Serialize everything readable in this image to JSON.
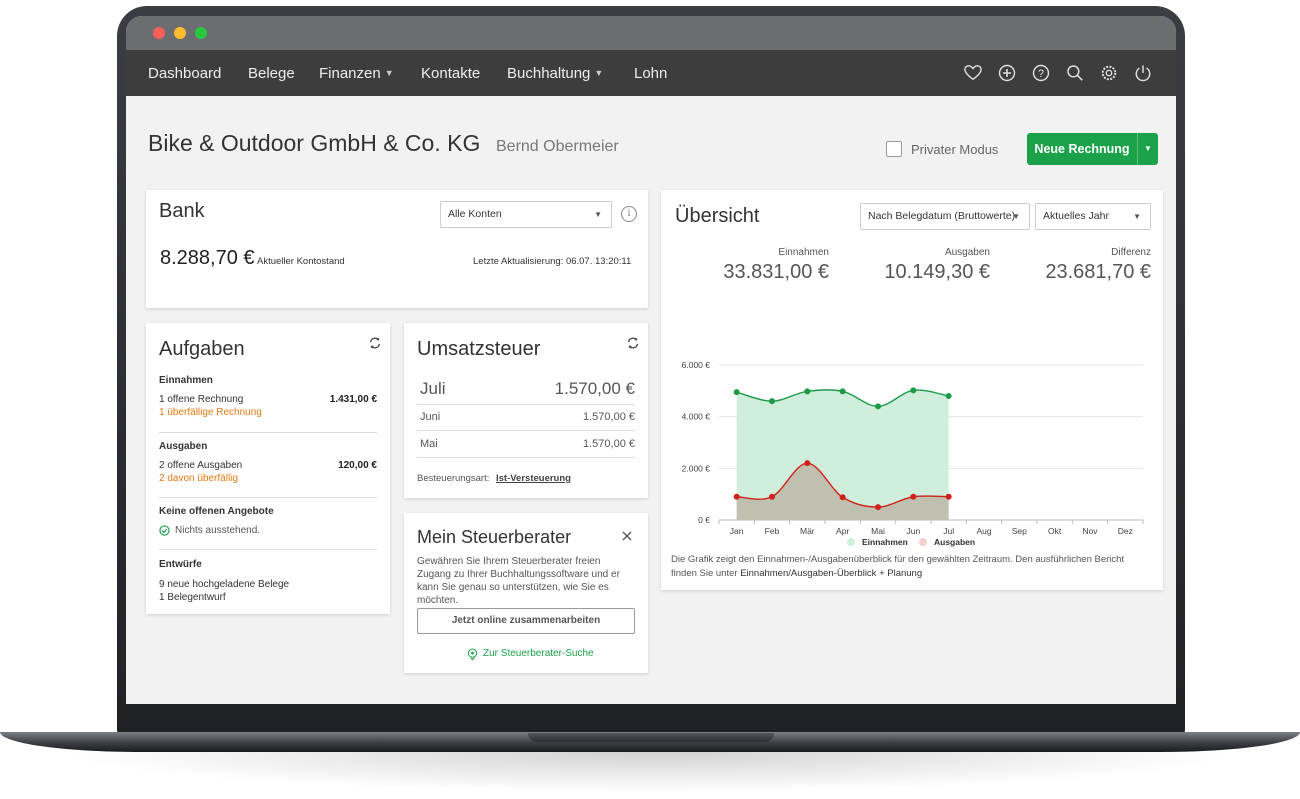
{
  "nav": {
    "items": [
      {
        "label": "Dashboard",
        "dropdown": false
      },
      {
        "label": "Belege",
        "dropdown": false
      },
      {
        "label": "Finanzen",
        "dropdown": true
      },
      {
        "label": "Kontakte",
        "dropdown": false
      },
      {
        "label": "Buchhaltung",
        "dropdown": true
      },
      {
        "label": "Lohn",
        "dropdown": false
      }
    ],
    "icons": [
      "heart-icon",
      "plus-circle-icon",
      "help-icon",
      "search-icon",
      "settings-icon",
      "power-icon"
    ]
  },
  "header": {
    "company": "Bike & Outdoor GmbH & Co. KG",
    "user": "Bernd Obermeier",
    "private_mode_label": "Privater Modus",
    "new_invoice_label": "Neue Rechnung"
  },
  "bank": {
    "title": "Bank",
    "account_select": "Alle Konten",
    "balance": "8.288,70 €",
    "balance_label": "Aktueller Kontostand",
    "last_update": "Letzte Aktualisierung: 06.07.  13:20:11"
  },
  "tasks": {
    "title": "Aufgaben",
    "income_heading": "Einnahmen",
    "income_open": "1  offene Rechnung",
    "income_open_amount": "1.431,00 €",
    "income_overdue": "1  überfällige Rechnung",
    "expenses_heading": "Ausgaben",
    "expenses_open": "2  offene Ausgaben",
    "expenses_open_amount": "120,00 €",
    "expenses_overdue": "2  davon überfällig",
    "offers_heading": "Keine offenen Angebote",
    "offers_status": "Nichts ausstehend.",
    "drafts_heading": "Entwürfe",
    "drafts_uploaded": "9  neue hochgeladene Belege",
    "drafts_draft": "1  Belegentwurf"
  },
  "vat": {
    "title": "Umsatzsteuer",
    "rows": [
      {
        "month": "Juli",
        "amount": "1.570,00 €"
      },
      {
        "month": "Juni",
        "amount": "1.570,00 €"
      },
      {
        "month": "Mai",
        "amount": "1.570,00 €"
      }
    ],
    "tax_type_label": "Besteuerungsart:",
    "tax_type_value": "Ist-Versteuerung"
  },
  "advisor": {
    "title": "Mein Steuerberater",
    "text": "Gewähren Sie Ihrem Steuerberater freien Zugang zu Ihrer Buchhaltungssoftware und er kann Sie genau so unterstützen, wie Sie es möchten.",
    "button": "Jetzt online zusammenarbeiten",
    "link": "Zur Steuerberater-Suche"
  },
  "overview": {
    "title": "Übersicht",
    "date_select": "Nach Belegdatum (Bruttowerte)",
    "period_select": "Aktuelles Jahr",
    "income_label": "Einnahmen",
    "income_value": "33.831,00 €",
    "expenses_label": "Ausgaben",
    "expenses_value": "10.149,30 €",
    "difference_label": "Differenz",
    "difference_value": "23.681,70 €",
    "note_text": "Die Grafik zeigt den Einnahmen-/Ausgabenüberblick für den gewählten Zeitraum. Den ausführlichen Bericht finden Sie unter ",
    "note_link": "Einnahmen/Ausgaben-Überblick + Planung"
  },
  "colors": {
    "accent": "#1aa14a",
    "warning": "#e07a12",
    "income_line": "#1d9a48",
    "income_fill": "#cfeedc",
    "expense_line": "#d0211c",
    "expense_fill": "#b9b0a0"
  },
  "chart_data": {
    "type": "line",
    "categories": [
      "Jan",
      "Feb",
      "Mär",
      "Apr",
      "Mai",
      "Jun",
      "Jul",
      "Aug",
      "Sep",
      "Okt",
      "Nov",
      "Dez"
    ],
    "yticks": [
      "6.000 €",
      "4.000 €",
      "2.000 €",
      "0 €"
    ],
    "ylim": [
      0,
      6000
    ],
    "grid": true,
    "legend": "bottom",
    "series": [
      {
        "name": "Einnahmen",
        "values": [
          4950,
          4600,
          4980,
          4980,
          4400,
          5020,
          4800
        ]
      },
      {
        "name": "Ausgaben",
        "values": [
          900,
          900,
          2200,
          880,
          500,
          900,
          900
        ]
      }
    ]
  }
}
